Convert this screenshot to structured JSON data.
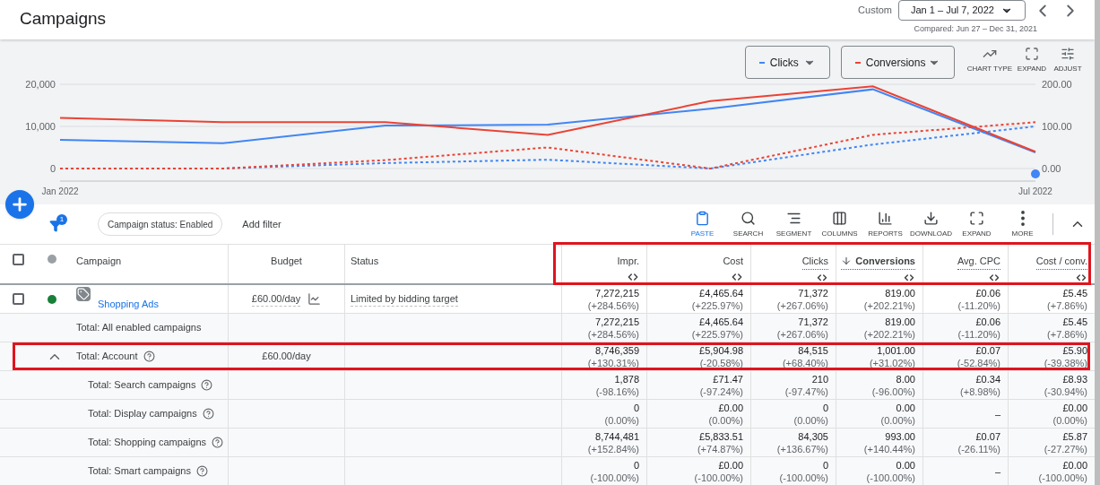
{
  "header": {
    "title": "Campaigns",
    "range_label": "Custom",
    "date_range": "Jan 1 – Jul 7, 2022",
    "compared": "Compared: Jun 27 – Dec 31, 2021"
  },
  "chart_controls": {
    "tools": [
      "CHART TYPE",
      "EXPAND",
      "ADJUST"
    ]
  },
  "chart_data": {
    "type": "line",
    "categories": [
      "Jan 2022",
      null,
      null,
      null,
      null,
      null,
      "Jul 2022"
    ],
    "ylim": [
      0,
      20000
    ],
    "yticks": [
      {
        "value": 0,
        "label": "0"
      },
      {
        "value": 10000,
        "label": "10,000"
      },
      {
        "value": 20000,
        "label": "20,000"
      }
    ],
    "y2lim": [
      0,
      200
    ],
    "y2ticks": [
      {
        "value": 0,
        "label": "0.00"
      },
      {
        "value": 100,
        "label": "100.00"
      },
      {
        "value": 200,
        "label": "200.00"
      }
    ],
    "series": [
      {
        "name": "Clicks",
        "color": "#4285f4",
        "values": [
          6800,
          6000,
          10200,
          10400,
          14200,
          18800,
          3800
        ]
      },
      {
        "name": "Conversions",
        "color": "#ea4335",
        "axis": "y2",
        "values": [
          120,
          110,
          110,
          80,
          160,
          195,
          40
        ]
      },
      {
        "color": "#4285f4",
        "line_style": "dashed",
        "values": [
          0,
          0,
          1300,
          2100,
          0,
          5700,
          10000
        ]
      },
      {
        "color": "#ea4335",
        "axis": "y2",
        "line_style": "dashed",
        "values": [
          0,
          0,
          20,
          50,
          0,
          80,
          110
        ]
      }
    ]
  },
  "filters": {
    "count": "1",
    "chips": [
      "Campaign status: Enabled"
    ],
    "add_label": "Add filter"
  },
  "toolbar": [
    {
      "label": "PASTE",
      "selected": true
    },
    {
      "label": "SEARCH",
      "selected": false
    },
    {
      "label": "SEGMENT",
      "selected": false
    },
    {
      "label": "COLUMNS",
      "selected": false
    },
    {
      "label": "REPORTS",
      "selected": false
    },
    {
      "label": "DOWNLOAD",
      "selected": false
    },
    {
      "label": "EXPAND",
      "selected": false
    },
    {
      "label": "MORE",
      "selected": false
    }
  ],
  "table": {
    "select_all_checked": false,
    "columns": {
      "campaign": "Campaign",
      "budget": "Budget",
      "status": "Status"
    },
    "metric_columns_highlighted": true,
    "metric_columns": [
      {
        "label": "Impr.",
        "sorted": false,
        "defined": false
      },
      {
        "label": "Cost",
        "sorted": false,
        "defined": false
      },
      {
        "label": "Clicks",
        "sorted": false,
        "defined": true
      },
      {
        "label": "Conversions",
        "sorted": true,
        "defined": true
      },
      {
        "label": "Avg. CPC",
        "sorted": false,
        "defined": true
      },
      {
        "label": "Cost / conv.",
        "sorted": false,
        "defined": true
      }
    ],
    "rows": [
      {
        "kind": "campaign",
        "checked": false,
        "color": "#188038",
        "name": "Shopping Ads",
        "budget": "£60.00/day",
        "status": "Limited by bidding target",
        "metrics": [
          [
            "7,272,215",
            "(+284.56%)"
          ],
          [
            "£4,465.64",
            "(+225.97%)"
          ],
          [
            "71,372",
            "(+267.06%)"
          ],
          [
            "819.00",
            "(+202.21%)"
          ],
          [
            "£0.06",
            "(-11.20%)"
          ],
          [
            "£5.45",
            "(+7.86%)"
          ]
        ]
      },
      {
        "kind": "total",
        "name": "Total: All enabled campaigns",
        "help": false,
        "metrics": [
          [
            "7,272,215",
            "(+284.56%)"
          ],
          [
            "£4,465.64",
            "(+225.97%)"
          ],
          [
            "71,372",
            "(+267.06%)"
          ],
          [
            "819.00",
            "(+202.21%)"
          ],
          [
            "£0.06",
            "(-11.20%)"
          ],
          [
            "£5.45",
            "(+7.86%)"
          ]
        ]
      },
      {
        "kind": "total",
        "name": "Total: Account",
        "help": true,
        "expanded": true,
        "highlighted": true,
        "budget": "£60.00/day",
        "metrics": [
          [
            "8,746,359",
            "(+130.31%)"
          ],
          [
            "£5,904.98",
            "(-20.58%)"
          ],
          [
            "84,515",
            "(+68.40%)"
          ],
          [
            "1,001.00",
            "(+31.02%)"
          ],
          [
            "£0.07",
            "(-52.84%)"
          ],
          [
            "£5.90",
            "(-39.38%)"
          ]
        ],
        "children": [
          {
            "kind": "total",
            "name": "Total: Search campaigns",
            "help": true,
            "metrics": [
              [
                "1,878",
                "(-98.16%)"
              ],
              [
                "£71.47",
                "(-97.24%)"
              ],
              [
                "210",
                "(-97.47%)"
              ],
              [
                "8.00",
                "(-96.00%)"
              ],
              [
                "£0.34",
                "(+8.98%)"
              ],
              [
                "£8.93",
                "(-30.94%)"
              ]
            ]
          },
          {
            "kind": "total",
            "name": "Total: Display campaigns",
            "help": true,
            "metrics": [
              [
                "0",
                "(0.00%)"
              ],
              [
                "£0.00",
                "(0.00%)"
              ],
              [
                "0",
                "(0.00%)"
              ],
              [
                "0.00",
                "(0.00%)"
              ],
              [
                "–"
              ],
              [
                "£0.00",
                "(0.00%)"
              ]
            ]
          },
          {
            "kind": "total",
            "name": "Total: Shopping campaigns",
            "help": true,
            "metrics": [
              [
                "8,744,481",
                "(+152.84%)"
              ],
              [
                "£5,833.51",
                "(+74.87%)"
              ],
              [
                "84,305",
                "(+136.67%)"
              ],
              [
                "993.00",
                "(+140.44%)"
              ],
              [
                "£0.07",
                "(-26.11%)"
              ],
              [
                "£5.87",
                "(-27.27%)"
              ]
            ]
          },
          {
            "kind": "total",
            "name": "Total: Smart campaigns",
            "help": true,
            "metrics": [
              [
                "0",
                "(-100.00%)"
              ],
              [
                "£0.00",
                "(-100.00%)"
              ],
              [
                "0",
                "(-100.00%)"
              ],
              [
                "0.00",
                "(-100.00%)"
              ],
              [
                "–"
              ],
              [
                "£0.00",
                "(-100.00%)"
              ]
            ]
          }
        ]
      }
    ]
  }
}
